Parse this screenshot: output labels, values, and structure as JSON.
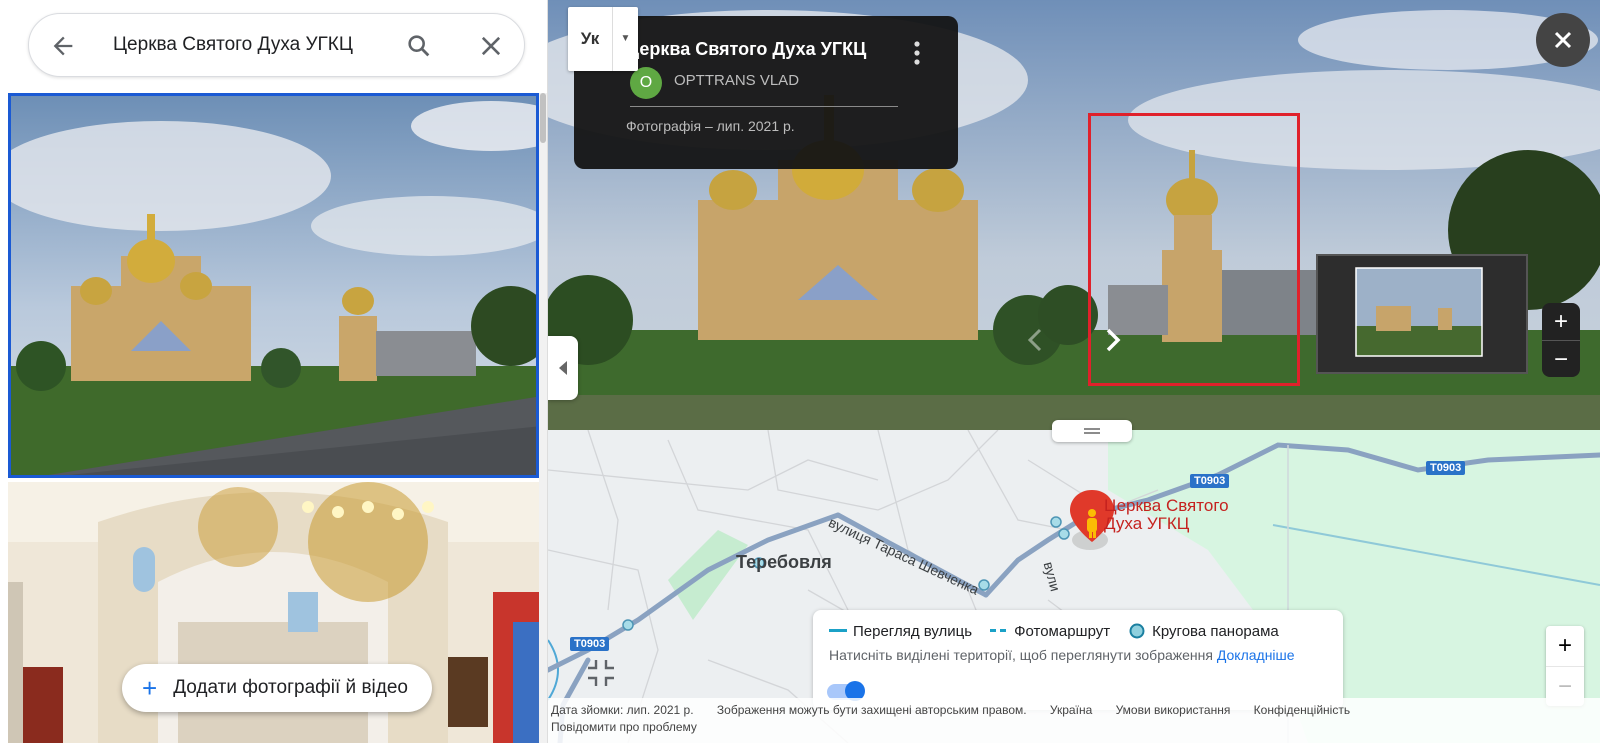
{
  "search": {
    "query": "Церква Святого Духа УГКЦ"
  },
  "left_panel": {
    "add_photos_label": "Додати фотографії й відео"
  },
  "photo_viewer": {
    "title": "Церква Святого Духа УГКЦ",
    "author_initial": "O",
    "author": "OPTTRANS VLAD",
    "meta": "Фотографія – лип. 2021 р.",
    "language_button": "Ук"
  },
  "map": {
    "place_label_line1": "Церква Святого",
    "place_label_line2": "Духа УГКЦ",
    "town_label": "Теребовля",
    "street_label": "вулиця Тараса Шевченка",
    "street_label_2": "вули",
    "road_shields": [
      "T0903",
      "T0903",
      "T0903"
    ],
    "legend": {
      "street_view": "Перегляд вулиць",
      "photo_route": "Фотомаршрут",
      "panorama": "Кругова панорама",
      "hint": "Натисніть виділені території, щоб переглянути зображення",
      "learn_more": "Докладніше"
    }
  },
  "footer": {
    "capture_date": "Дата зйомки: лип. 2021 р.",
    "copyright": "Зображення можуть бути захищені авторським правом.",
    "country": "Україна",
    "terms": "Умови використання",
    "privacy": "Конфіденційність",
    "report": "Повідомити про проблему"
  },
  "colors": {
    "accent": "#1a73e8",
    "selection_border": "#1a5ad4",
    "highlight_box": "#e0212b",
    "avatar": "#5fa843"
  }
}
